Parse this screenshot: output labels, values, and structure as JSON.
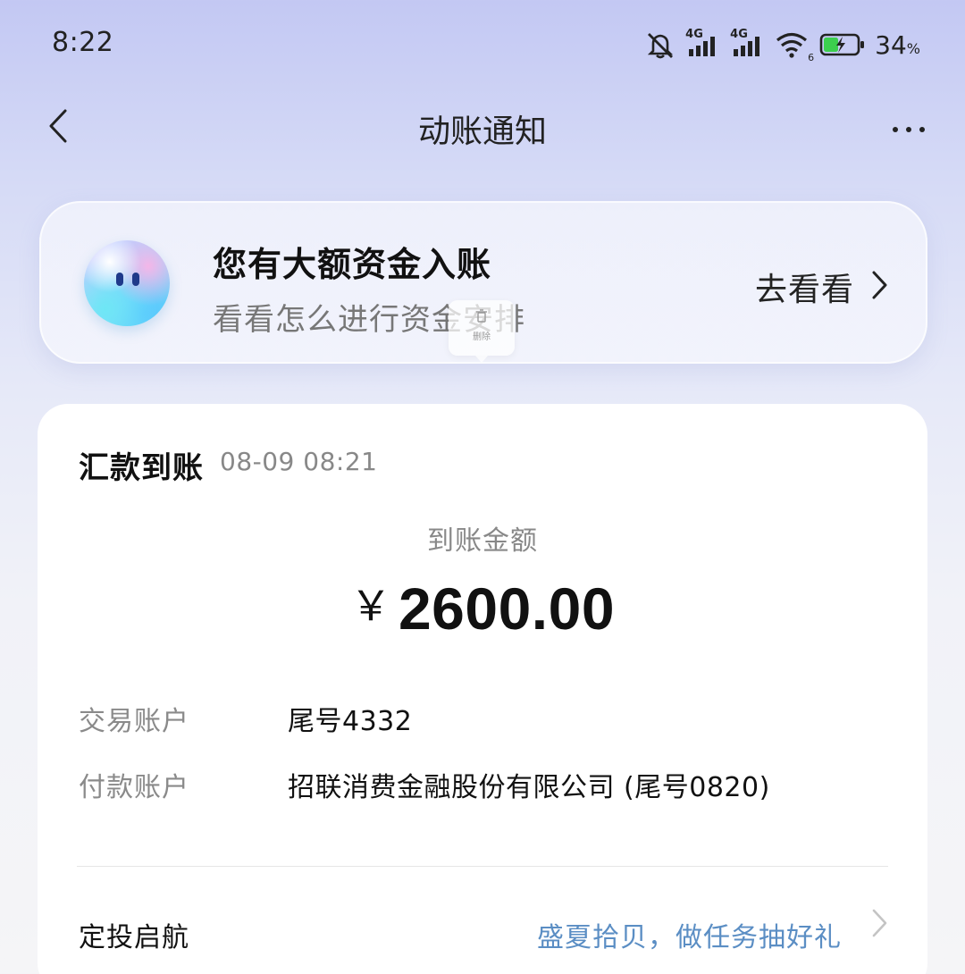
{
  "status_bar": {
    "time": "8:22",
    "network_1": "4G",
    "network_2": "4G",
    "wifi_label": "6",
    "battery_percent": "34",
    "battery_unit": "%",
    "icons": [
      "mute-icon",
      "signal-4g-icon",
      "signal-4g-icon",
      "wifi-icon",
      "battery-charging-icon"
    ]
  },
  "nav": {
    "title": "动账通知",
    "back_icon": "chevron-left-icon",
    "more_icon": "more-horizontal-icon"
  },
  "promo": {
    "title": "您有大额资金入账",
    "subtitle": "看看怎么进行资金安排",
    "action_label": "去看看",
    "delete_tip": "删除"
  },
  "transaction": {
    "type": "汇款到账",
    "time": "08-09 08:21",
    "amount_label": "到账金额",
    "currency_symbol": "￥",
    "amount": "2600.00",
    "details": [
      {
        "label": "交易账户",
        "value": "尾号4332"
      },
      {
        "label": "付款账户",
        "value": "招联消费金融股份有限公司 (尾号0820)"
      }
    ],
    "promo_row": {
      "label": "定投启航",
      "link": "盛夏拾贝，做任务抽好礼"
    }
  },
  "colors": {
    "link": "#5b8ec4",
    "muted_text": "#888888",
    "card_bg": "#ffffff"
  }
}
